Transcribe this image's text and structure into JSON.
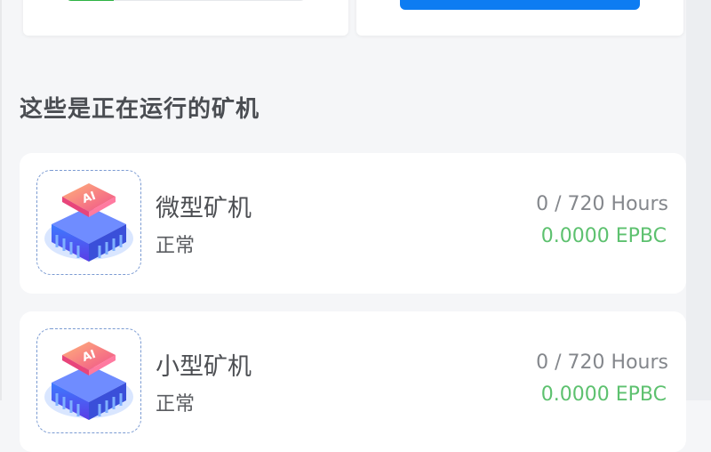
{
  "top_panels": {
    "left_progress": {
      "fraction": 0.2
    },
    "right_action": {
      "color": "#0d7cf2"
    }
  },
  "section": {
    "title": "这些是正在运行的矿机"
  },
  "miners": [
    {
      "name": "微型矿机",
      "status": "正常",
      "hours": "0 / 720 Hours",
      "reward": "0.0000 EPBC",
      "icon": "ai-chip-icon"
    },
    {
      "name": "小型矿机",
      "status": "正常",
      "hours": "0 / 720 Hours",
      "reward": "0.0000 EPBC",
      "icon": "ai-chip-icon"
    }
  ],
  "colors": {
    "progress": "#2db343",
    "action": "#0d7cf2",
    "reward": "#5dc16f",
    "title": "#4a4d52"
  }
}
